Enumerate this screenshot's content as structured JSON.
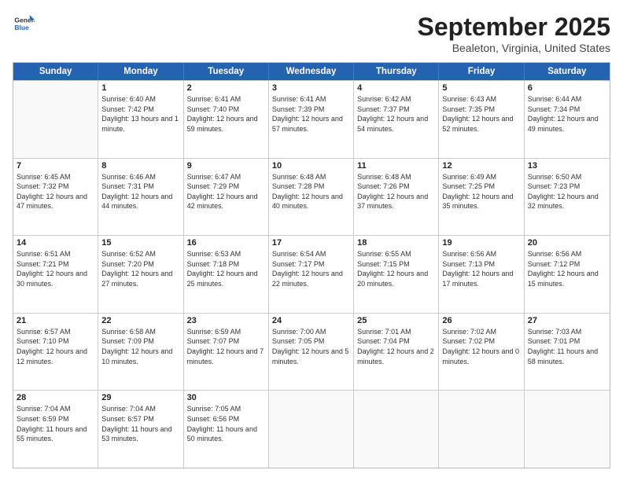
{
  "header": {
    "logo": {
      "general": "General",
      "blue": "Blue"
    },
    "title": "September 2025",
    "location": "Bealeton, Virginia, United States"
  },
  "days_of_week": [
    "Sunday",
    "Monday",
    "Tuesday",
    "Wednesday",
    "Thursday",
    "Friday",
    "Saturday"
  ],
  "weeks": [
    [
      {
        "day": "",
        "sunrise": "",
        "sunset": "",
        "daylight": ""
      },
      {
        "day": "1",
        "sunrise": "Sunrise: 6:40 AM",
        "sunset": "Sunset: 7:42 PM",
        "daylight": "Daylight: 13 hours and 1 minute."
      },
      {
        "day": "2",
        "sunrise": "Sunrise: 6:41 AM",
        "sunset": "Sunset: 7:40 PM",
        "daylight": "Daylight: 12 hours and 59 minutes."
      },
      {
        "day": "3",
        "sunrise": "Sunrise: 6:41 AM",
        "sunset": "Sunset: 7:39 PM",
        "daylight": "Daylight: 12 hours and 57 minutes."
      },
      {
        "day": "4",
        "sunrise": "Sunrise: 6:42 AM",
        "sunset": "Sunset: 7:37 PM",
        "daylight": "Daylight: 12 hours and 54 minutes."
      },
      {
        "day": "5",
        "sunrise": "Sunrise: 6:43 AM",
        "sunset": "Sunset: 7:35 PM",
        "daylight": "Daylight: 12 hours and 52 minutes."
      },
      {
        "day": "6",
        "sunrise": "Sunrise: 6:44 AM",
        "sunset": "Sunset: 7:34 PM",
        "daylight": "Daylight: 12 hours and 49 minutes."
      }
    ],
    [
      {
        "day": "7",
        "sunrise": "Sunrise: 6:45 AM",
        "sunset": "Sunset: 7:32 PM",
        "daylight": "Daylight: 12 hours and 47 minutes."
      },
      {
        "day": "8",
        "sunrise": "Sunrise: 6:46 AM",
        "sunset": "Sunset: 7:31 PM",
        "daylight": "Daylight: 12 hours and 44 minutes."
      },
      {
        "day": "9",
        "sunrise": "Sunrise: 6:47 AM",
        "sunset": "Sunset: 7:29 PM",
        "daylight": "Daylight: 12 hours and 42 minutes."
      },
      {
        "day": "10",
        "sunrise": "Sunrise: 6:48 AM",
        "sunset": "Sunset: 7:28 PM",
        "daylight": "Daylight: 12 hours and 40 minutes."
      },
      {
        "day": "11",
        "sunrise": "Sunrise: 6:48 AM",
        "sunset": "Sunset: 7:26 PM",
        "daylight": "Daylight: 12 hours and 37 minutes."
      },
      {
        "day": "12",
        "sunrise": "Sunrise: 6:49 AM",
        "sunset": "Sunset: 7:25 PM",
        "daylight": "Daylight: 12 hours and 35 minutes."
      },
      {
        "day": "13",
        "sunrise": "Sunrise: 6:50 AM",
        "sunset": "Sunset: 7:23 PM",
        "daylight": "Daylight: 12 hours and 32 minutes."
      }
    ],
    [
      {
        "day": "14",
        "sunrise": "Sunrise: 6:51 AM",
        "sunset": "Sunset: 7:21 PM",
        "daylight": "Daylight: 12 hours and 30 minutes."
      },
      {
        "day": "15",
        "sunrise": "Sunrise: 6:52 AM",
        "sunset": "Sunset: 7:20 PM",
        "daylight": "Daylight: 12 hours and 27 minutes."
      },
      {
        "day": "16",
        "sunrise": "Sunrise: 6:53 AM",
        "sunset": "Sunset: 7:18 PM",
        "daylight": "Daylight: 12 hours and 25 minutes."
      },
      {
        "day": "17",
        "sunrise": "Sunrise: 6:54 AM",
        "sunset": "Sunset: 7:17 PM",
        "daylight": "Daylight: 12 hours and 22 minutes."
      },
      {
        "day": "18",
        "sunrise": "Sunrise: 6:55 AM",
        "sunset": "Sunset: 7:15 PM",
        "daylight": "Daylight: 12 hours and 20 minutes."
      },
      {
        "day": "19",
        "sunrise": "Sunrise: 6:56 AM",
        "sunset": "Sunset: 7:13 PM",
        "daylight": "Daylight: 12 hours and 17 minutes."
      },
      {
        "day": "20",
        "sunrise": "Sunrise: 6:56 AM",
        "sunset": "Sunset: 7:12 PM",
        "daylight": "Daylight: 12 hours and 15 minutes."
      }
    ],
    [
      {
        "day": "21",
        "sunrise": "Sunrise: 6:57 AM",
        "sunset": "Sunset: 7:10 PM",
        "daylight": "Daylight: 12 hours and 12 minutes."
      },
      {
        "day": "22",
        "sunrise": "Sunrise: 6:58 AM",
        "sunset": "Sunset: 7:09 PM",
        "daylight": "Daylight: 12 hours and 10 minutes."
      },
      {
        "day": "23",
        "sunrise": "Sunrise: 6:59 AM",
        "sunset": "Sunset: 7:07 PM",
        "daylight": "Daylight: 12 hours and 7 minutes."
      },
      {
        "day": "24",
        "sunrise": "Sunrise: 7:00 AM",
        "sunset": "Sunset: 7:05 PM",
        "daylight": "Daylight: 12 hours and 5 minutes."
      },
      {
        "day": "25",
        "sunrise": "Sunrise: 7:01 AM",
        "sunset": "Sunset: 7:04 PM",
        "daylight": "Daylight: 12 hours and 2 minutes."
      },
      {
        "day": "26",
        "sunrise": "Sunrise: 7:02 AM",
        "sunset": "Sunset: 7:02 PM",
        "daylight": "Daylight: 12 hours and 0 minutes."
      },
      {
        "day": "27",
        "sunrise": "Sunrise: 7:03 AM",
        "sunset": "Sunset: 7:01 PM",
        "daylight": "Daylight: 11 hours and 58 minutes."
      }
    ],
    [
      {
        "day": "28",
        "sunrise": "Sunrise: 7:04 AM",
        "sunset": "Sunset: 6:59 PM",
        "daylight": "Daylight: 11 hours and 55 minutes."
      },
      {
        "day": "29",
        "sunrise": "Sunrise: 7:04 AM",
        "sunset": "Sunset: 6:57 PM",
        "daylight": "Daylight: 11 hours and 53 minutes."
      },
      {
        "day": "30",
        "sunrise": "Sunrise: 7:05 AM",
        "sunset": "Sunset: 6:56 PM",
        "daylight": "Daylight: 11 hours and 50 minutes."
      },
      {
        "day": "",
        "sunrise": "",
        "sunset": "",
        "daylight": ""
      },
      {
        "day": "",
        "sunrise": "",
        "sunset": "",
        "daylight": ""
      },
      {
        "day": "",
        "sunrise": "",
        "sunset": "",
        "daylight": ""
      },
      {
        "day": "",
        "sunrise": "",
        "sunset": "",
        "daylight": ""
      }
    ]
  ]
}
